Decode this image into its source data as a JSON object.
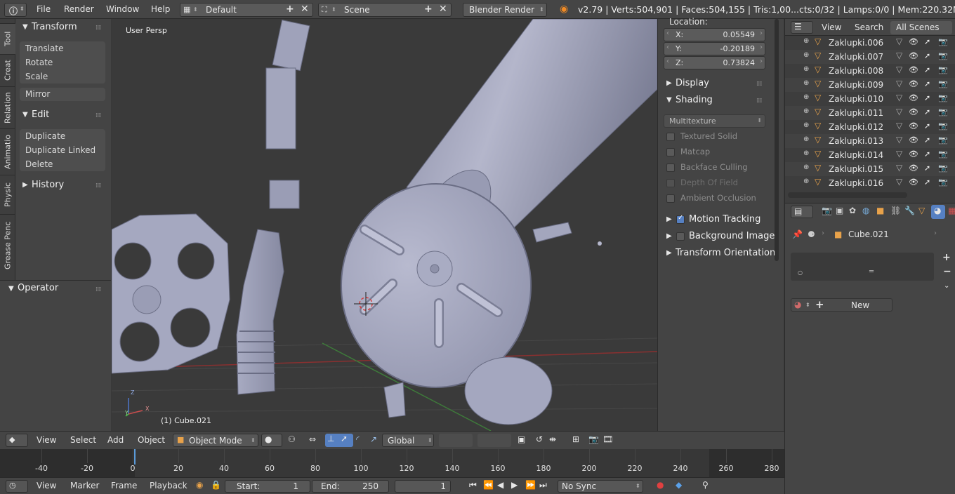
{
  "topbar": {
    "menus": [
      "File",
      "Render",
      "Window",
      "Help"
    ],
    "screen_layout": "Default",
    "scene": "Scene",
    "render_engine": "Blender Render",
    "stats": "v2.79 | Verts:504,901 | Faces:504,155 | Tris:1,00...cts:0/32 | Lamps:0/0 | Mem:220.32M"
  },
  "tabs": [
    "Tool",
    "Creat",
    "Relation",
    "Animatio",
    "Physic",
    "Grease Penc"
  ],
  "toolshelf": {
    "transform_title": "Transform",
    "transform_items": [
      "Translate",
      "Rotate",
      "Scale"
    ],
    "mirror": "Mirror",
    "edit_title": "Edit",
    "edit_items": [
      "Duplicate",
      "Duplicate Linked",
      "Delete"
    ],
    "history_title": "History"
  },
  "operator": {
    "title": "Operator"
  },
  "viewport": {
    "view_label": "User Persp",
    "object_label": "(1) Cube.021",
    "axis_labels": [
      "Z",
      "Y",
      "X"
    ]
  },
  "npanel": {
    "location_label": "Location:",
    "x_label": "X:",
    "x_value": "0.05549",
    "y_label": "Y:",
    "y_value": "-0.20189",
    "z_label": "Z:",
    "z_value": "0.73824",
    "display": "Display",
    "shading": "Shading",
    "shading_mode": "Multitexture",
    "options": [
      "Textured Solid",
      "Matcap",
      "Backface Culling",
      "Depth Of Field",
      "Ambient Occlusion"
    ],
    "motion_tracking": "Motion Tracking",
    "background_images": "Background Image",
    "transform_orientations": "Transform Orientation"
  },
  "outliner": {
    "tabs": [
      "View",
      "Search",
      "All Scenes"
    ],
    "items": [
      "Zaklupki.006",
      "Zaklupki.007",
      "Zaklupki.008",
      "Zaklupki.009",
      "Zaklupki.010",
      "Zaklupki.011",
      "Zaklupki.012",
      "Zaklupki.013",
      "Zaklupki.014",
      "Zaklupki.015",
      "Zaklupki.016"
    ]
  },
  "properties": {
    "object_name": "Cube.021",
    "new_button": "New"
  },
  "viewport_header": {
    "menus": [
      "View",
      "Select",
      "Add",
      "Object"
    ],
    "mode": "Object Mode",
    "orientation": "Global"
  },
  "timeline": {
    "ticks": [
      "-40",
      "-20",
      "0",
      "20",
      "40",
      "60",
      "80",
      "100",
      "120",
      "140",
      "160",
      "180",
      "200",
      "220",
      "240",
      "260",
      "280"
    ]
  },
  "timeline_header": {
    "menus": [
      "View",
      "Marker",
      "Frame",
      "Playback"
    ],
    "start_label": "Start:",
    "start_value": "1",
    "end_label": "End:",
    "end_value": "250",
    "current_frame": "1",
    "sync": "No Sync"
  },
  "colors": {
    "accent_blue": "#5680c2",
    "outliner_orange": "#e8a24a",
    "playhead": "#5a9ad8"
  }
}
